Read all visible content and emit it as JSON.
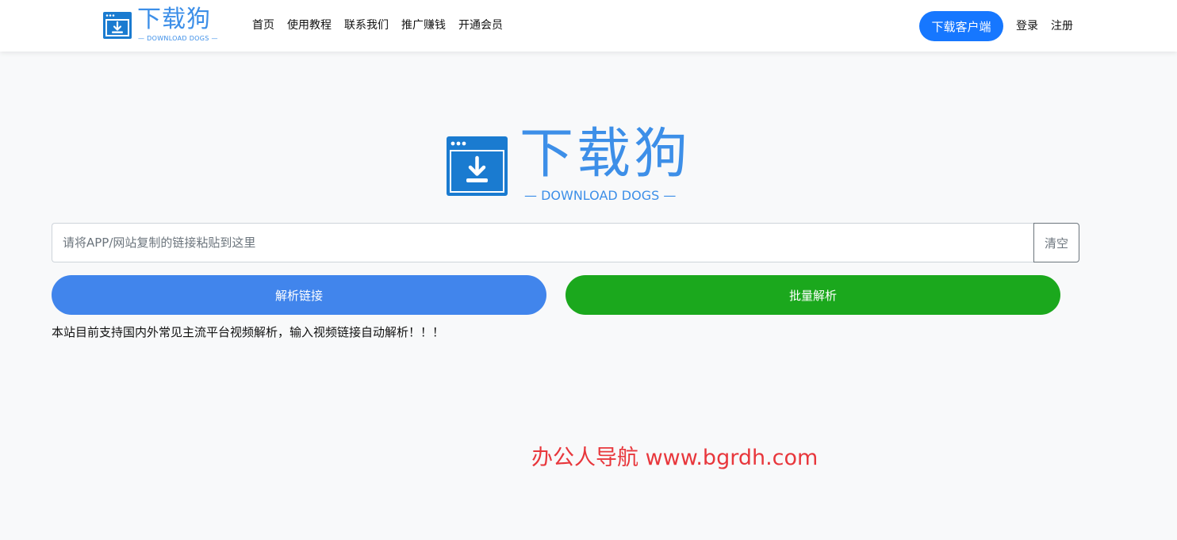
{
  "header": {
    "logo_title": "下载狗",
    "logo_subtitle": "— DOWNLOAD DOGS —",
    "nav": [
      {
        "label": "首页"
      },
      {
        "label": "使用教程"
      },
      {
        "label": "联系我们"
      },
      {
        "label": "推广赚钱"
      },
      {
        "label": "开通会员"
      }
    ],
    "client_button": "下载客户端",
    "login": "登录",
    "register": "注册"
  },
  "hero": {
    "title": "下载狗",
    "subtitle": "— DOWNLOAD DOGS —"
  },
  "search": {
    "placeholder": "请将APP/网站复制的链接粘贴到这里",
    "value": "",
    "clear_label": "清空"
  },
  "actions": {
    "parse_label": "解析链接",
    "batch_label": "批量解析"
  },
  "notice": "本站目前支持国内外常见主流平台视频解析，输入视频链接自动解析！！！",
  "watermark": "办公人导航 www.bgrdh.com",
  "colors": {
    "brand_blue": "#3d8fe8",
    "client_button": "#1677ff",
    "parse_button": "#4185ec",
    "batch_button": "#1ba81d",
    "watermark": "#e8373c"
  },
  "icons": {
    "logo": "download-window-icon"
  }
}
